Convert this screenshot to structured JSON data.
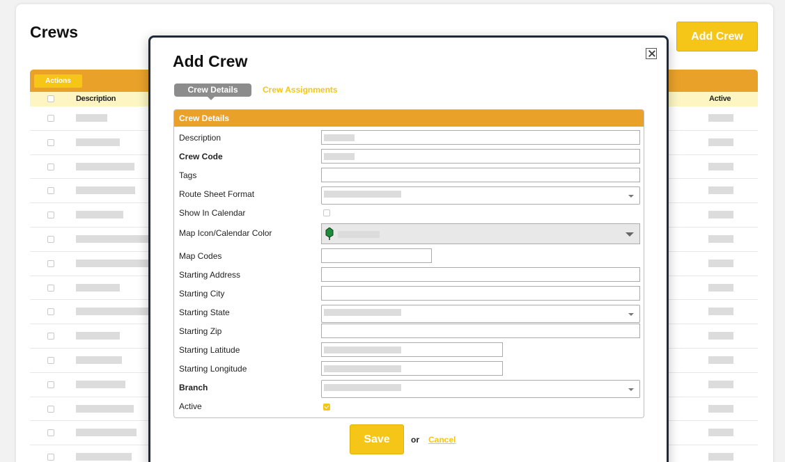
{
  "page": {
    "title": "Crews",
    "add_button_label": "Add Crew"
  },
  "table": {
    "actions_label": "Actions",
    "columns": {
      "description": "Description",
      "active": "Active"
    }
  },
  "modal": {
    "title": "Add Crew",
    "tabs": [
      {
        "label": "Crew Details",
        "active": true
      },
      {
        "label": "Crew Assignments",
        "active": false
      }
    ],
    "section_title": "Crew Details",
    "fields": {
      "description": {
        "label": "Description"
      },
      "crew_code": {
        "label": "Crew Code"
      },
      "tags": {
        "label": "Tags"
      },
      "route_sheet_format": {
        "label": "Route Sheet Format"
      },
      "show_in_calendar": {
        "label": "Show In Calendar",
        "checked": false
      },
      "map_icon_color": {
        "label": "Map Icon/Calendar Color",
        "icon": "map-pin-icon",
        "color": "#1e8a3c"
      },
      "map_codes": {
        "label": "Map Codes"
      },
      "starting_address": {
        "label": "Starting Address"
      },
      "starting_city": {
        "label": "Starting City"
      },
      "starting_state": {
        "label": "Starting State"
      },
      "starting_zip": {
        "label": "Starting Zip"
      },
      "starting_latitude": {
        "label": "Starting Latitude"
      },
      "starting_longitude": {
        "label": "Starting Longitude"
      },
      "branch": {
        "label": "Branch"
      },
      "active": {
        "label": "Active",
        "checked": true
      }
    },
    "save_label": "Save",
    "or_text": "or",
    "cancel_label": "Cancel"
  },
  "colors": {
    "accent_yellow": "#f5c518",
    "header_orange": "#e9a12a",
    "column_header_bg": "#fdf6c3",
    "tab_gray": "#8c8c8c",
    "modal_border": "#1e2a3a"
  }
}
